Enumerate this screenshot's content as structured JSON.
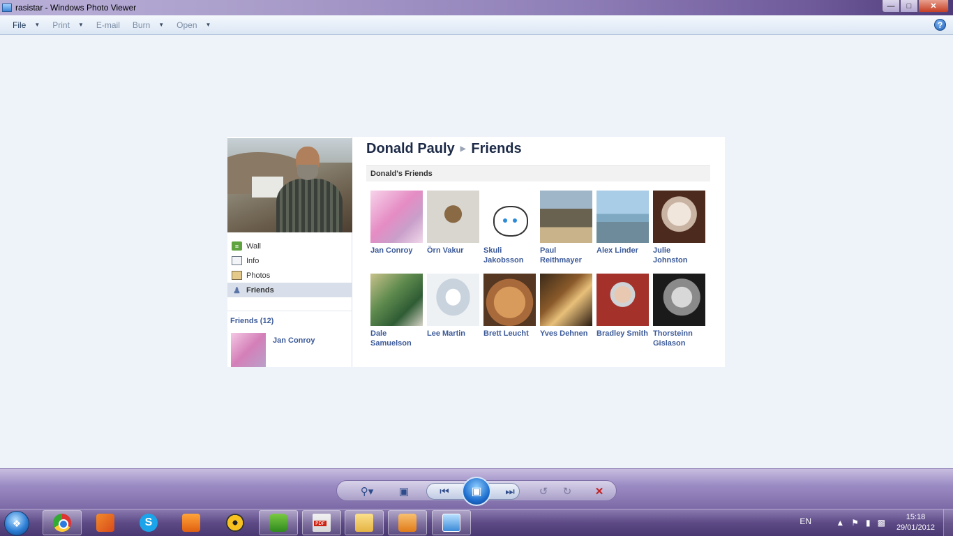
{
  "window": {
    "title": "rasistar - Windows Photo Viewer"
  },
  "menu": {
    "items": [
      {
        "label": "File",
        "caret": true,
        "enabled": true
      },
      {
        "label": "Print",
        "caret": true,
        "enabled": false
      },
      {
        "label": "E-mail",
        "caret": false,
        "enabled": false
      },
      {
        "label": "Burn",
        "caret": true,
        "enabled": false
      },
      {
        "label": "Open",
        "caret": true,
        "enabled": false
      }
    ],
    "help": "?"
  },
  "profile": {
    "name": "Donald Pauly",
    "section": "Friends",
    "nav": [
      {
        "label": "Wall",
        "icon": "wall-icon"
      },
      {
        "label": "Info",
        "icon": "info-icon"
      },
      {
        "label": "Photos",
        "icon": "photos-icon"
      },
      {
        "label": "Friends",
        "icon": "friends-icon",
        "active": true
      }
    ],
    "friends_count_label": "Friends (12)",
    "mini_friend": "Jan Conroy",
    "friends_heading": "Donald's Friends",
    "friends": [
      {
        "name": "Jan Conroy"
      },
      {
        "name": "Örn Vakur"
      },
      {
        "name": "Skuli Jakobsson"
      },
      {
        "name": "Paul Reithmayer"
      },
      {
        "name": "Alex Linder"
      },
      {
        "name": "Julie Johnston"
      },
      {
        "name": "Dale Samuelson"
      },
      {
        "name": "Lee Martin"
      },
      {
        "name": "Brett Leucht"
      },
      {
        "name": "Yves Dehnen"
      },
      {
        "name": "Bradley Smith"
      },
      {
        "name": "Thorsteinn Gislason"
      }
    ]
  },
  "taskbar": {
    "language": "EN",
    "time": "15:18",
    "date": "29/01/2012"
  }
}
